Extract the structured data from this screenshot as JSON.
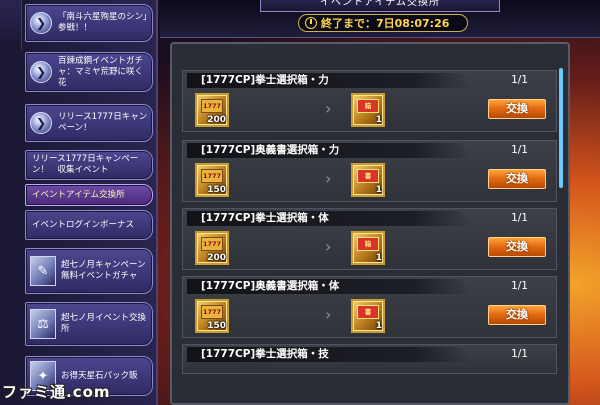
{
  "header": {
    "title": "イベントアイテム交換所",
    "timer_text": "終了まで：7日08:07:26"
  },
  "sidebar": {
    "items": [
      {
        "label": "「南斗六星殉星のシン」参戦！！",
        "kind": "icon",
        "icon": "arrow-circle-icon"
      },
      {
        "label": "百鍊成鋼イベントガチャ：マミヤ荒野に咲く花",
        "kind": "icon",
        "icon": "arrow-circle-icon"
      },
      {
        "label": "リリース1777日キャンペーン！",
        "kind": "icon",
        "icon": "arrow-circle-icon"
      },
      {
        "label": "リリース1777日キャンペーン！　収集イベント",
        "kind": "plain"
      },
      {
        "label": "イベントアイテム交換所",
        "kind": "plain",
        "active": true
      },
      {
        "label": "イベントログインボーナス",
        "kind": "plain"
      },
      {
        "label": "超七ノ月キャンペーン　無料イベントガチャ",
        "kind": "thumb",
        "icon": "pen-icon"
      },
      {
        "label": "超七ノ月イベント交換所",
        "kind": "thumb",
        "icon": "scales-icon"
      },
      {
        "label": "お得天星石パック販",
        "kind": "thumb",
        "icon": "gem-icon"
      }
    ]
  },
  "rows": [
    {
      "title": "[1777CP]拳士選択箱・力",
      "count": "1/1",
      "cost_qty": "200",
      "cost_emblem": "1777",
      "reward_qty": "1",
      "reward_emblem": "箱",
      "button": "交換"
    },
    {
      "title": "[1777CP]奥義書選択箱・力",
      "count": "1/1",
      "cost_qty": "150",
      "cost_emblem": "1777",
      "reward_qty": "1",
      "reward_emblem": "書",
      "button": "交換"
    },
    {
      "title": "[1777CP]拳士選択箱・体",
      "count": "1/1",
      "cost_qty": "200",
      "cost_emblem": "1777",
      "reward_qty": "1",
      "reward_emblem": "箱",
      "button": "交換"
    },
    {
      "title": "[1777CP]奥義書選択箱・体",
      "count": "1/1",
      "cost_qty": "150",
      "cost_emblem": "1777",
      "reward_qty": "1",
      "reward_emblem": "書",
      "button": "交換"
    },
    {
      "title": "[1777CP]拳士選択箱・技",
      "count": "1/1"
    }
  ],
  "watermark": "ファミ通.com",
  "colors": {
    "accent_orange": "#e06810",
    "timer_gold": "#ffd34a",
    "sidebar_purple": "#4d4790"
  }
}
